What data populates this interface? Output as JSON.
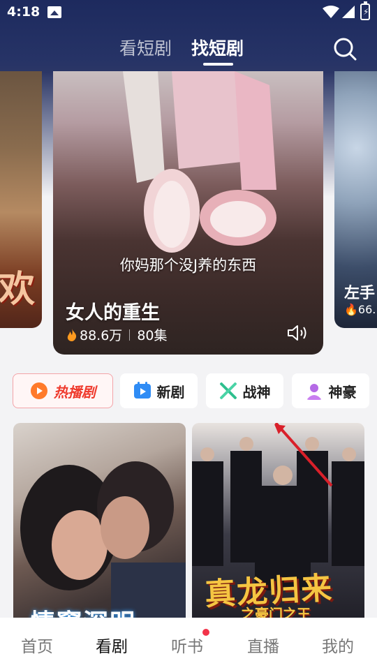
{
  "status_bar": {
    "time": "4:18",
    "icons": [
      "image-icon",
      "wifi-icon",
      "signal-icon",
      "battery-charging-icon"
    ]
  },
  "header": {
    "tabs": [
      {
        "label": "看短剧",
        "active": false
      },
      {
        "label": "找短剧",
        "active": true
      }
    ],
    "search_icon": "search-icon"
  },
  "carousel": {
    "main": {
      "subtitle": "你妈那个没J养的东西",
      "title": "女人的重生",
      "heat": "88.6万",
      "episodes": "80集",
      "icons": [
        "flame-icon",
        "volume-icon"
      ]
    },
    "left_peek": {
      "caption": "欢"
    },
    "right_peek": {
      "title": "左手",
      "heat": "66."
    }
  },
  "categories": [
    {
      "label": "热播剧",
      "icon": "flame-icon",
      "selected": true
    },
    {
      "label": "新剧",
      "icon": "play-icon",
      "selected": false
    },
    {
      "label": "战神",
      "icon": "crossed-swords-icon",
      "selected": false
    },
    {
      "label": "神豪",
      "icon": "person-icon",
      "selected": false
    }
  ],
  "posters": [
    {
      "title": "情窦深明"
    },
    {
      "title": "真龙归来",
      "subtitle": "之豪门之王"
    }
  ],
  "bottom_nav": [
    {
      "label": "首页",
      "active": false
    },
    {
      "label": "看剧",
      "active": true
    },
    {
      "label": "听书",
      "active": false,
      "badge_dot": true
    },
    {
      "label": "直播",
      "active": false
    },
    {
      "label": "我的",
      "active": false
    }
  ],
  "colors": {
    "header_bg": "#1d2a5e",
    "hot_accent": "#ef3b2e",
    "badge_dot": "#f2344a",
    "active_nav": "#111111",
    "inactive_nav": "#777777"
  }
}
